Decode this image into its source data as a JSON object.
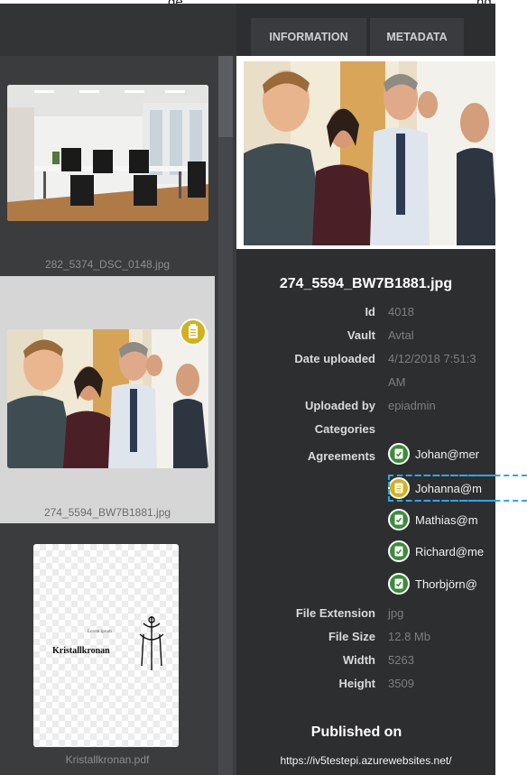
{
  "header_fragment": {
    "left_text": "ge",
    "right_text": "ng"
  },
  "tabs": {
    "information": "INFORMATION",
    "metadata": "METADATA"
  },
  "gallery": {
    "items": [
      {
        "caption": "282_5374_DSC_0148.jpg"
      },
      {
        "caption": "274_5594_BW7B1881.jpg"
      },
      {
        "caption": "Kristallkronan.pdf",
        "thumb_text": "Kristallkronan"
      }
    ]
  },
  "details": {
    "file_name": "274_5594_BW7B1881.jpg",
    "fields": [
      {
        "label": "Id",
        "value": "4018"
      },
      {
        "label": "Vault",
        "value": "Avtal"
      },
      {
        "label": "Date uploaded",
        "value": "4/12/2018 7:51:3",
        "value_line2": "AM"
      },
      {
        "label": "Uploaded by",
        "value": "epiadmin"
      },
      {
        "label": "Categories",
        "value": ""
      },
      {
        "label": "Agreements",
        "value": ""
      },
      {
        "label": "File Extension",
        "value": "jpg"
      },
      {
        "label": "File Size",
        "value": "12.8 Mb"
      },
      {
        "label": "Width",
        "value": "5263"
      },
      {
        "label": "Height",
        "value": "3509"
      }
    ],
    "agreements": [
      {
        "name": "Johan@mer",
        "status": "approved"
      },
      {
        "name": "Johanna@m",
        "status": "pending"
      },
      {
        "name": "Mathias@m",
        "status": "approved"
      },
      {
        "name": "Richard@me",
        "status": "approved"
      },
      {
        "name": "Thorbjörn@",
        "status": "approved"
      }
    ],
    "published_heading": "Published on",
    "published_url": "https://iv5testepi.azurewebsites.net/"
  },
  "colors": {
    "approved": "#3d8b3d",
    "pending": "#d1b21d",
    "highlight": "#2aa8e8",
    "panel": "#2d2e30"
  }
}
